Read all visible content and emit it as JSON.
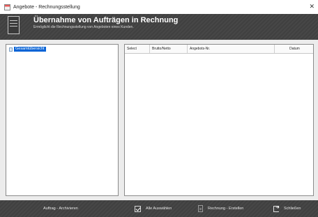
{
  "window": {
    "title": "Angebote - Rechnungsstellung",
    "close_glyph": "✕"
  },
  "header": {
    "title": "Übernahme von Aufträgen in Rechnung",
    "subtitle": "Ermöglicht die Rechnungsstellung von Angeboten eines Kunden.",
    "icon": "document-list-icon"
  },
  "tree": {
    "items": [
      {
        "label": "Gesamtübersicht",
        "icon": "folder-icon",
        "selected": true
      }
    ]
  },
  "list": {
    "columns": [
      "Select",
      "Brutto/Netto",
      "Angebots-Nr.",
      "Datum"
    ],
    "rows": []
  },
  "footer": {
    "archive_label": "Auftrag - Archivieren",
    "select_all_label": "Alle Auswählen",
    "invoice_label": "Rechnung - Erstellen",
    "close_label": "Schließen"
  }
}
